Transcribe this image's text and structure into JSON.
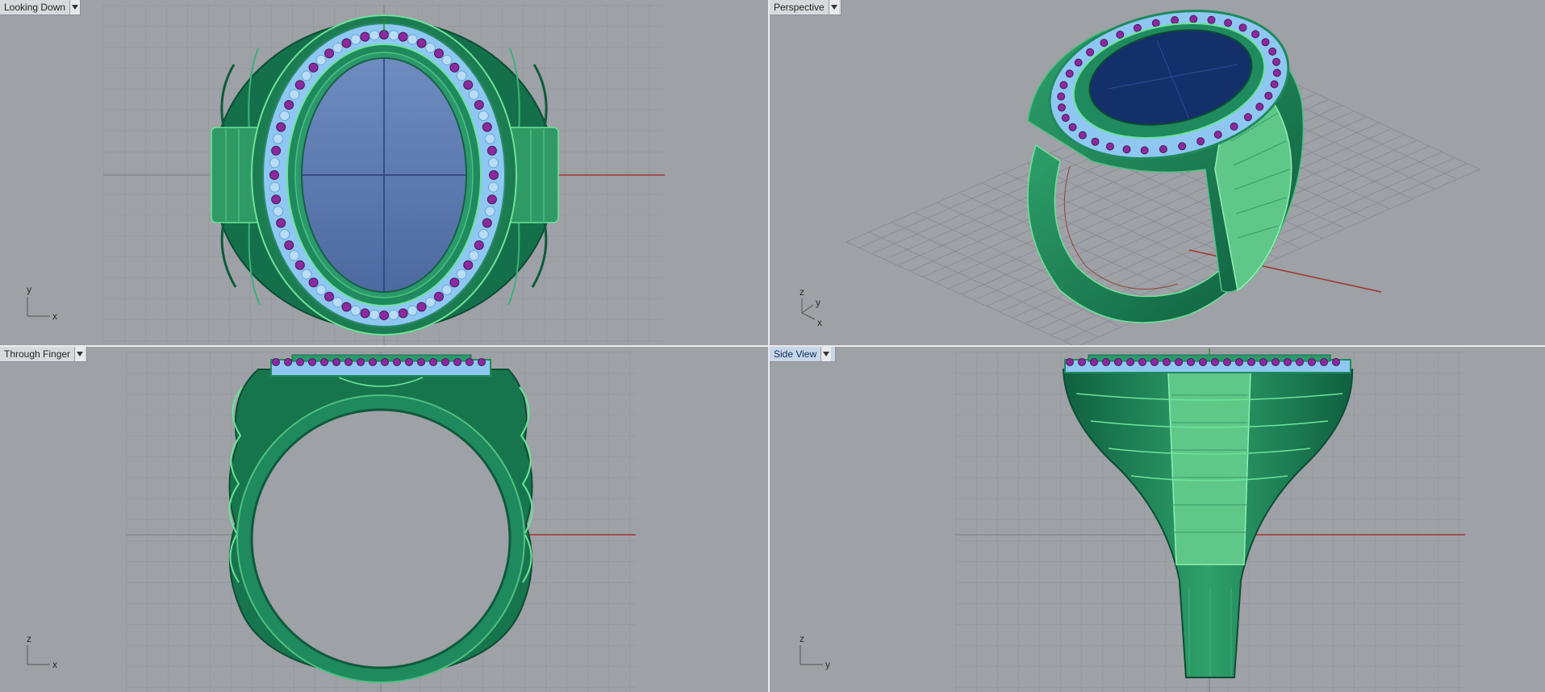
{
  "viewports": [
    {
      "id": "top",
      "label": "Looking Down",
      "active": false,
      "axis_a": "y",
      "axis_b": "x"
    },
    {
      "id": "persp",
      "label": "Perspective",
      "active": false,
      "axis_a": "z",
      "axis_b": "y",
      "axis_c": "x"
    },
    {
      "id": "front",
      "label": "Through Finger",
      "active": false,
      "axis_a": "z",
      "axis_b": "x"
    },
    {
      "id": "side",
      "label": "Side View",
      "active": true,
      "axis_a": "z",
      "axis_b": "y"
    }
  ],
  "colors": {
    "viewport_bg": "#9ea1a6",
    "grid_line": "#8a8d92",
    "ring_metal": "#1f8a5e",
    "ring_highlight": "#6ee39a",
    "diamond": "#8ec8f2",
    "amethyst": "#8a2a9e",
    "stone_top": "#5f7fb2",
    "stone_persp": "#14306a",
    "x_axis": "#a0352e",
    "y_axis": "#2a8a2a"
  },
  "icons": {
    "dropdown": "chevron-down-icon"
  }
}
